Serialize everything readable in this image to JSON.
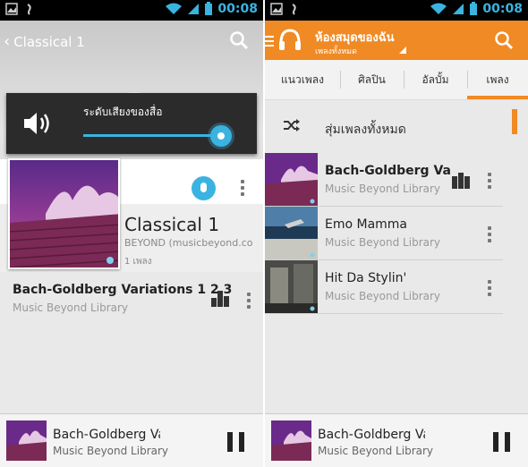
{
  "status_bar": {
    "time": "00:08"
  },
  "left_screen": {
    "back_title": "Classical 1",
    "volume_panel": {
      "label": "ระดับเสียงของสื่อ",
      "level": 0.95
    },
    "album": {
      "title": "Classical 1",
      "artist": "BEYOND (musicbeyond.co",
      "count": "1 เพลง"
    },
    "song": {
      "title": "Bach-Goldberg Variations 1 2 3",
      "subtitle": "Music Beyond Library"
    },
    "now_playing": {
      "title": "Bach-Goldberg Va",
      "subtitle": "Music Beyond Library"
    }
  },
  "right_screen": {
    "action_bar": {
      "title": "ห้องสมุดของฉัน",
      "subtitle": "เพลงทั้งหมด"
    },
    "tabs": [
      {
        "label": "แนวเพลง"
      },
      {
        "label": "ศิลปิน"
      },
      {
        "label": "อัลบั้ม"
      },
      {
        "label": "เพลง"
      }
    ],
    "active_tab": "เพลง",
    "shuffle_label": "สุ่มเพลงทั้งหมด",
    "songs": [
      {
        "title": "Bach-Goldberg Varia",
        "subtitle": "Music Beyond Library",
        "playing": true
      },
      {
        "title": "Emo Mamma",
        "subtitle": "Music Beyond Library",
        "playing": false
      },
      {
        "title": "Hit Da Stylin'",
        "subtitle": "Music Beyond Library",
        "playing": false
      }
    ],
    "now_playing": {
      "title": "Bach-Goldberg Va",
      "subtitle": "Music Beyond Library"
    }
  },
  "colors": {
    "accent_blue": "#3bb3e0",
    "accent_orange": "#f08a24"
  }
}
